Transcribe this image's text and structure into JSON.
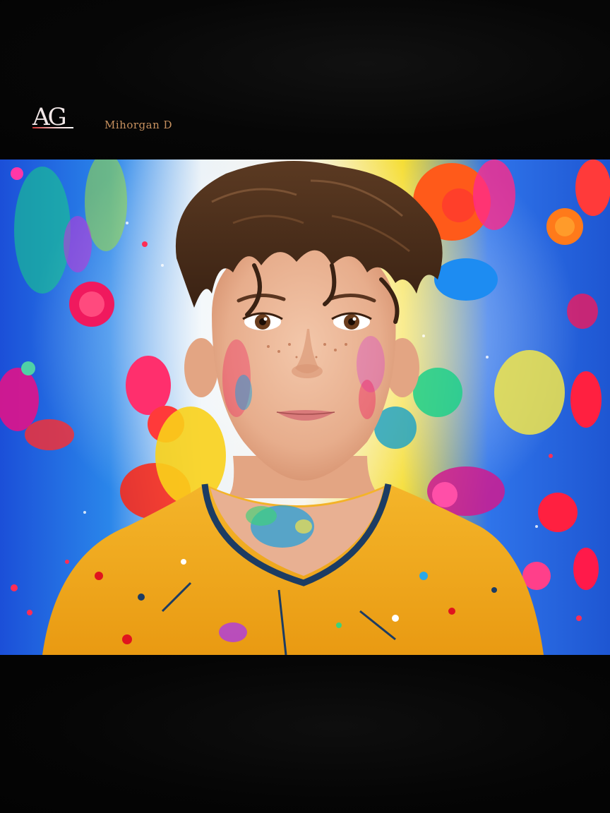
{
  "header": {
    "logo_text": "AG",
    "signature_text": "Mihorgan D"
  },
  "photo": {
    "subject": "boy-portrait",
    "colors": {
      "shirt": "#f2ad1f",
      "hair": "#4a2f1c",
      "skin": "#e9b496",
      "background_blue": "#1e63e6",
      "background_pink": "#f0195e",
      "background_yellow": "#f7e21d"
    }
  }
}
